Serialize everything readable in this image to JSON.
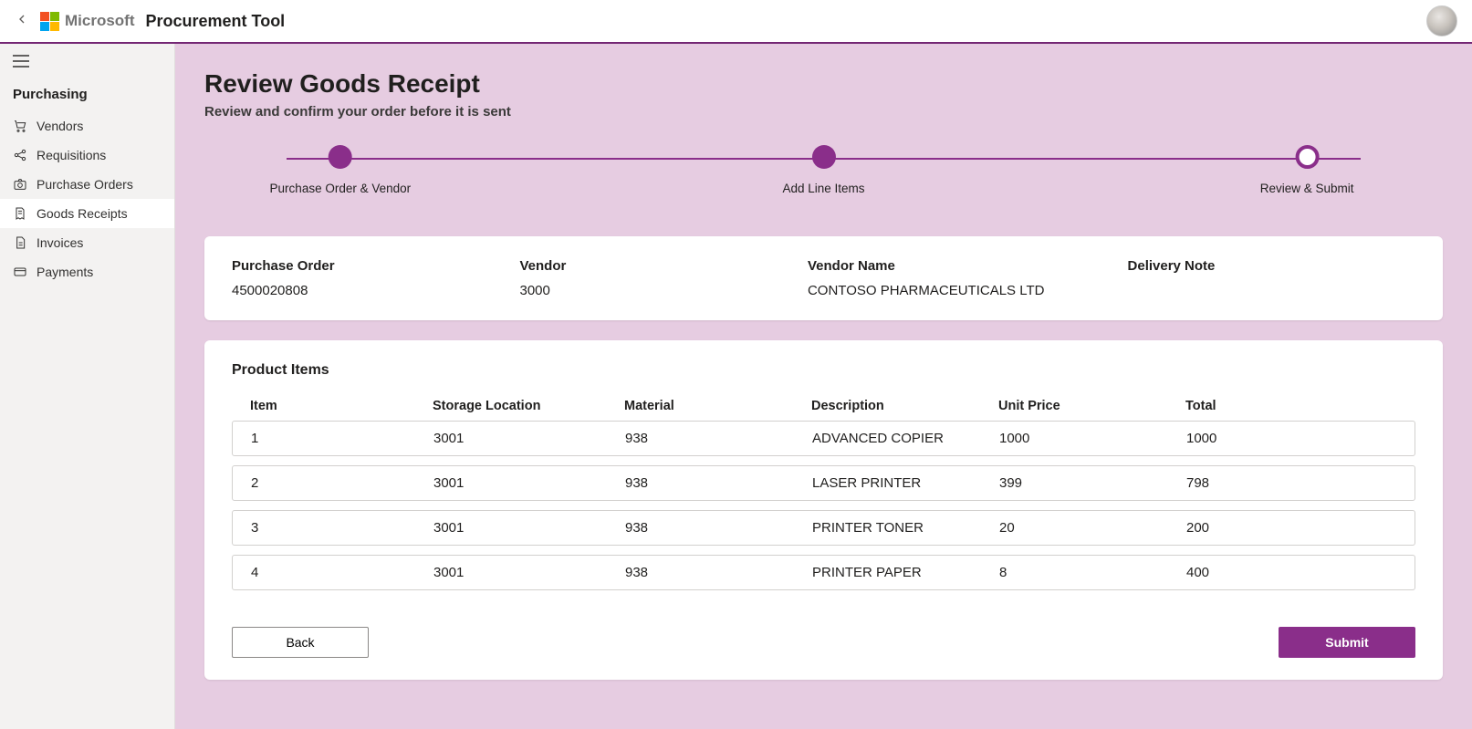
{
  "header": {
    "brand": "Microsoft",
    "app_title": "Procurement Tool"
  },
  "sidebar": {
    "section": "Purchasing",
    "items": [
      {
        "label": "Vendors",
        "icon": "cart-icon"
      },
      {
        "label": "Requisitions",
        "icon": "share-icon"
      },
      {
        "label": "Purchase Orders",
        "icon": "camera-icon"
      },
      {
        "label": "Goods Receipts",
        "icon": "receipt-icon"
      },
      {
        "label": "Invoices",
        "icon": "doc-icon"
      },
      {
        "label": "Payments",
        "icon": "card-icon"
      }
    ]
  },
  "page": {
    "title": "Review Goods Receipt",
    "subtitle": "Review and confirm your order before it is sent"
  },
  "stepper": [
    {
      "label": "Purchase Order & Vendor",
      "state": "done"
    },
    {
      "label": "Add Line Items",
      "state": "done"
    },
    {
      "label": "Review & Submit",
      "state": "current"
    }
  ],
  "summary": {
    "po_label": "Purchase Order",
    "po_value": "4500020808",
    "vendor_label": "Vendor",
    "vendor_value": "3000",
    "vendor_name_label": "Vendor Name",
    "vendor_name_value": "CONTOSO PHARMACEUTICALS LTD",
    "delivery_note_label": "Delivery Note",
    "delivery_note_value": ""
  },
  "products": {
    "title": "Product Items",
    "columns": {
      "item": "Item",
      "storage": "Storage Location",
      "material": "Material",
      "description": "Description",
      "unit_price": "Unit Price",
      "total": "Total"
    },
    "rows": [
      {
        "item": "1",
        "storage": "3001",
        "material": "938",
        "description": "ADVANCED COPIER",
        "unit_price": "1000",
        "total": "1000"
      },
      {
        "item": "2",
        "storage": "3001",
        "material": "938",
        "description": "LASER PRINTER",
        "unit_price": "399",
        "total": "798"
      },
      {
        "item": "3",
        "storage": "3001",
        "material": "938",
        "description": "PRINTER TONER",
        "unit_price": "20",
        "total": "200"
      },
      {
        "item": "4",
        "storage": "3001",
        "material": "938",
        "description": "PRINTER PAPER",
        "unit_price": "8",
        "total": "400"
      }
    ]
  },
  "actions": {
    "back": "Back",
    "submit": "Submit"
  }
}
